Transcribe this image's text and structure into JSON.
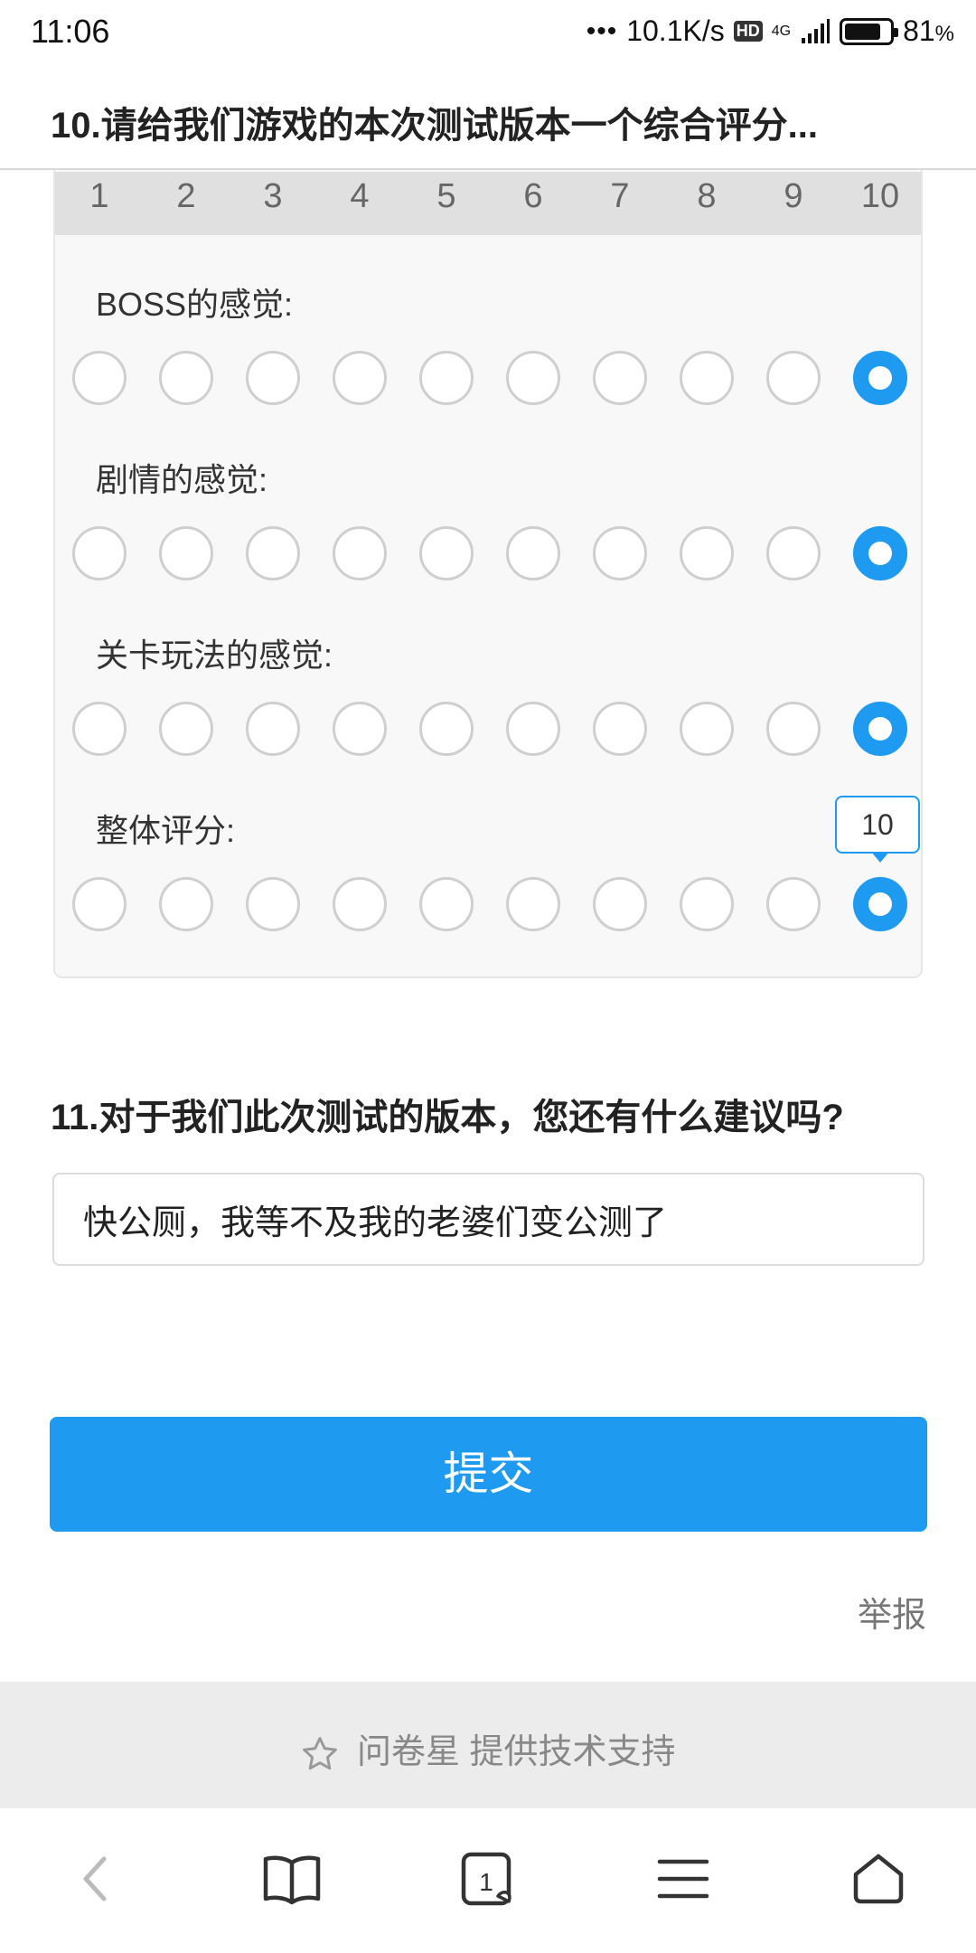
{
  "status_bar": {
    "time": "11:06",
    "net_speed": "10.1K/s",
    "hd_label": "HD",
    "network_type": "4G",
    "battery_percent": "81",
    "battery_suffix": "%",
    "battery_level": 0.81
  },
  "question10": {
    "title": "10.请给我们游戏的本次测试版本一个综合评分...",
    "scale": [
      "1",
      "2",
      "3",
      "4",
      "5",
      "6",
      "7",
      "8",
      "9",
      "10"
    ],
    "rows": [
      {
        "label": "BOSS的感觉:",
        "selected": 10
      },
      {
        "label": "剧情的感觉:",
        "selected": 10
      },
      {
        "label": "关卡玩法的感觉:",
        "selected": 10
      },
      {
        "label": "整体评分:",
        "selected": 10
      }
    ],
    "tooltip": "10"
  },
  "question11": {
    "title": "11.对于我们此次测试的版本，您还有什么建议吗?",
    "answer": "快公厕，我等不及我的老婆们变公测了"
  },
  "submit_label": "提交",
  "report_label": "举报",
  "footer": {
    "text": "问卷星 提供技术支持",
    "icon": "star-icon"
  },
  "navbar": {
    "tab_count": "1",
    "icons": [
      "back-icon",
      "bookmarks-icon",
      "tabs-icon",
      "menu-icon",
      "home-icon"
    ]
  },
  "colors": {
    "accent": "#1e9bf0",
    "radio_border": "#cfcfcf",
    "footer_bg": "#ececec"
  }
}
